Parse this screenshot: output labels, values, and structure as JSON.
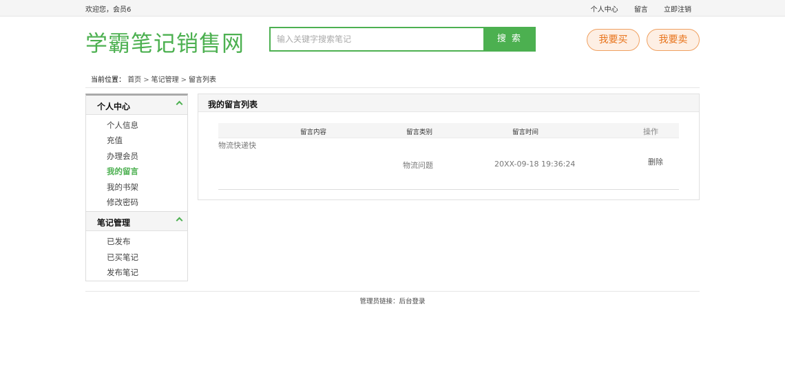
{
  "topbar": {
    "welcome": "欢迎您，会员6",
    "links": [
      "个人中心",
      "留言",
      "立即注销"
    ]
  },
  "header": {
    "logo": "学霸笔记销售网",
    "search_placeholder": "输入关键字搜索笔记",
    "search_button": "搜 索",
    "buy_button": "我要买",
    "sell_button": "我要卖"
  },
  "breadcrumb": {
    "label": "当前位置：",
    "items": [
      "首页",
      "笔记管理",
      "留言列表"
    ],
    "separator": ">"
  },
  "sidebar": {
    "groups": [
      {
        "title": "个人中心",
        "items": [
          "个人信息",
          "充值",
          "办理会员",
          "我的留言",
          "我的书架",
          "修改密码"
        ],
        "active": "我的留言"
      },
      {
        "title": "笔记管理",
        "items": [
          "已发布",
          "已买笔记",
          "发布笔记"
        ]
      }
    ]
  },
  "main": {
    "title": "我的留言列表",
    "columns": [
      "留言内容",
      "留言类别",
      "留言时间",
      "操作"
    ],
    "rows": [
      {
        "content": "物流快递快",
        "category": "物流问题",
        "time": "20XX-09-18 19:36:24",
        "action": "删除"
      }
    ]
  },
  "footer": {
    "label": "管理员链接：",
    "link": "后台登录"
  },
  "colors": {
    "accent_green": "#4cb050",
    "accent_orange": "#e8731a"
  }
}
